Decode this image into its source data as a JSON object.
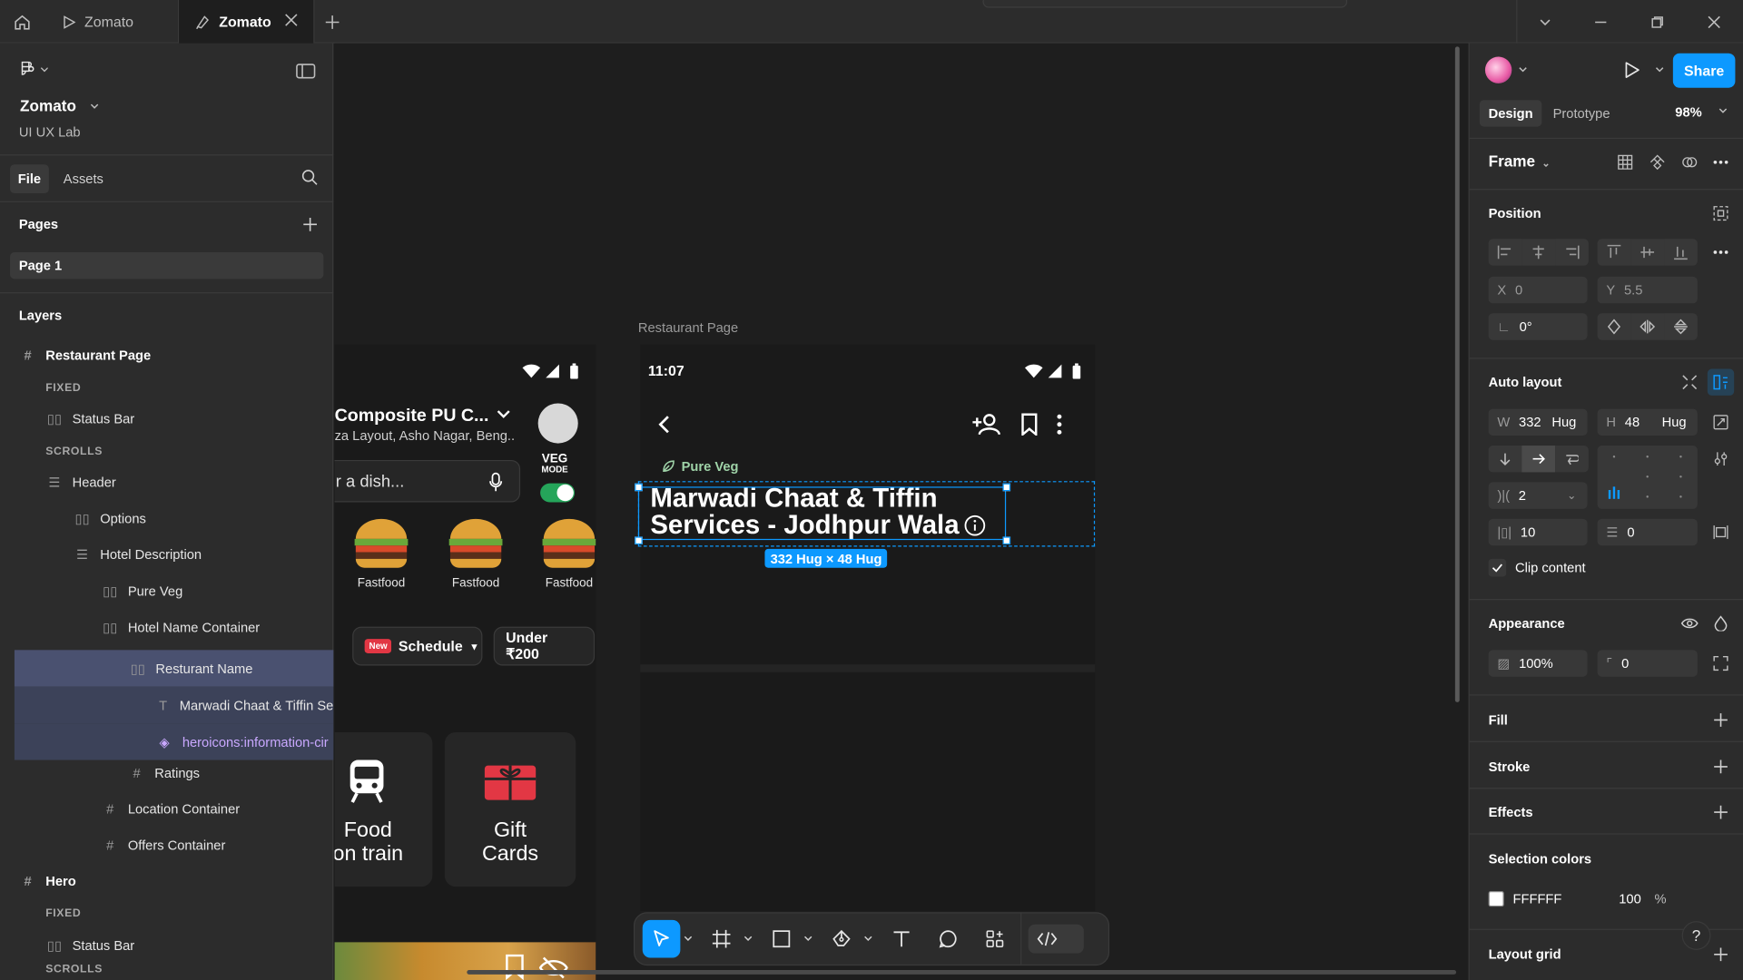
{
  "tabs": [
    {
      "label": "Zomato",
      "icon": "play-icon"
    },
    {
      "label": "Zomato",
      "icon": "figma-file-icon",
      "active": true
    }
  ],
  "left_panel": {
    "project_name": "Zomato",
    "team": "UI UX Lab",
    "file_tab": "File",
    "assets_tab": "Assets",
    "pages_heading": "Pages",
    "pages": [
      "Page 1"
    ],
    "layers_heading": "Layers",
    "layers": [
      {
        "label": "Restaurant Page",
        "icon": "frame-icon"
      },
      {
        "label": "FIXED"
      },
      {
        "label": "Status Bar",
        "icon": "autolayout-icon"
      },
      {
        "label": "SCROLLS"
      },
      {
        "label": "Header",
        "icon": "section-icon"
      },
      {
        "label": "Options",
        "icon": "autolayout-icon"
      },
      {
        "label": "Hotel Description",
        "icon": "section-icon"
      },
      {
        "label": "Pure Veg",
        "icon": "autolayout-icon"
      },
      {
        "label": "Hotel Name Container",
        "icon": "autolayout-icon"
      },
      {
        "label": "Resturant Name",
        "icon": "autolayout-icon"
      },
      {
        "label": "Marwadi Chaat & Tiffin Se",
        "icon": "text-icon"
      },
      {
        "label": "heroicons:information-cir",
        "icon": "component-icon"
      },
      {
        "label": "Ratings",
        "icon": "frame-icon"
      },
      {
        "label": "Location Container",
        "icon": "frame-icon"
      },
      {
        "label": "Offers Container",
        "icon": "frame-icon"
      },
      {
        "label": "Hero",
        "icon": "frame-icon"
      },
      {
        "label": "FIXED"
      },
      {
        "label": "Status Bar",
        "icon": "autolayout-icon"
      },
      {
        "label": "SCROLLS"
      }
    ]
  },
  "canvas": {
    "left_phone": {
      "title": "Composite PU C...",
      "subtitle": "za Layout, Asho Nagar, Beng..",
      "veg": "VEG",
      "mode": "MODE",
      "search_text": "r a dish...",
      "dishes": [
        "Fastfood",
        "Fastfood",
        "Fastfood"
      ],
      "chip_new": "New",
      "chip_schedule": "Schedule",
      "chip_price": "Under ₹200",
      "card1_line1": "Food",
      "card1_line2": "on train",
      "card2_line1": "Gift",
      "card2_line2": "Cards"
    },
    "frame_label": "Restaurant Page",
    "right_phone": {
      "time": "11:07",
      "pure_veg": "Pure Veg",
      "restaurant_name_l1": "Marwadi Chaat & Tiffin",
      "restaurant_name_l2": "Services - Jodhpur Wala"
    },
    "selection_dimensions": "332 Hug × 48 Hug"
  },
  "right_panel": {
    "share": "Share",
    "design_tab": "Design",
    "prototype_tab": "Prototype",
    "zoom": "98%",
    "frame_label": "Frame",
    "position_heading": "Position",
    "x_label": "X",
    "x_value": "0",
    "y_label": "Y",
    "y_value": "5.5",
    "rotation": "0°",
    "autolayout_heading": "Auto layout",
    "w_label": "W",
    "w_value": "332",
    "w_mode": "Hug",
    "h_label": "H",
    "h_value": "48",
    "h_mode": "Hug",
    "gap": "2",
    "padding_h": "10",
    "padding_v": "0",
    "clip_content": "Clip content",
    "appearance_heading": "Appearance",
    "opacity": "100%",
    "radius": "0",
    "fill_heading": "Fill",
    "stroke_heading": "Stroke",
    "effects_heading": "Effects",
    "selection_colors_heading": "Selection colors",
    "selection_color_hex": "FFFFFF",
    "selection_color_opacity": "100",
    "selection_color_pct": "%",
    "layout_grid_heading": "Layout grid"
  },
  "colors": {
    "accent": "#0d99ff",
    "zomato_red": "#e23744",
    "veg_green": "#25a55a"
  }
}
